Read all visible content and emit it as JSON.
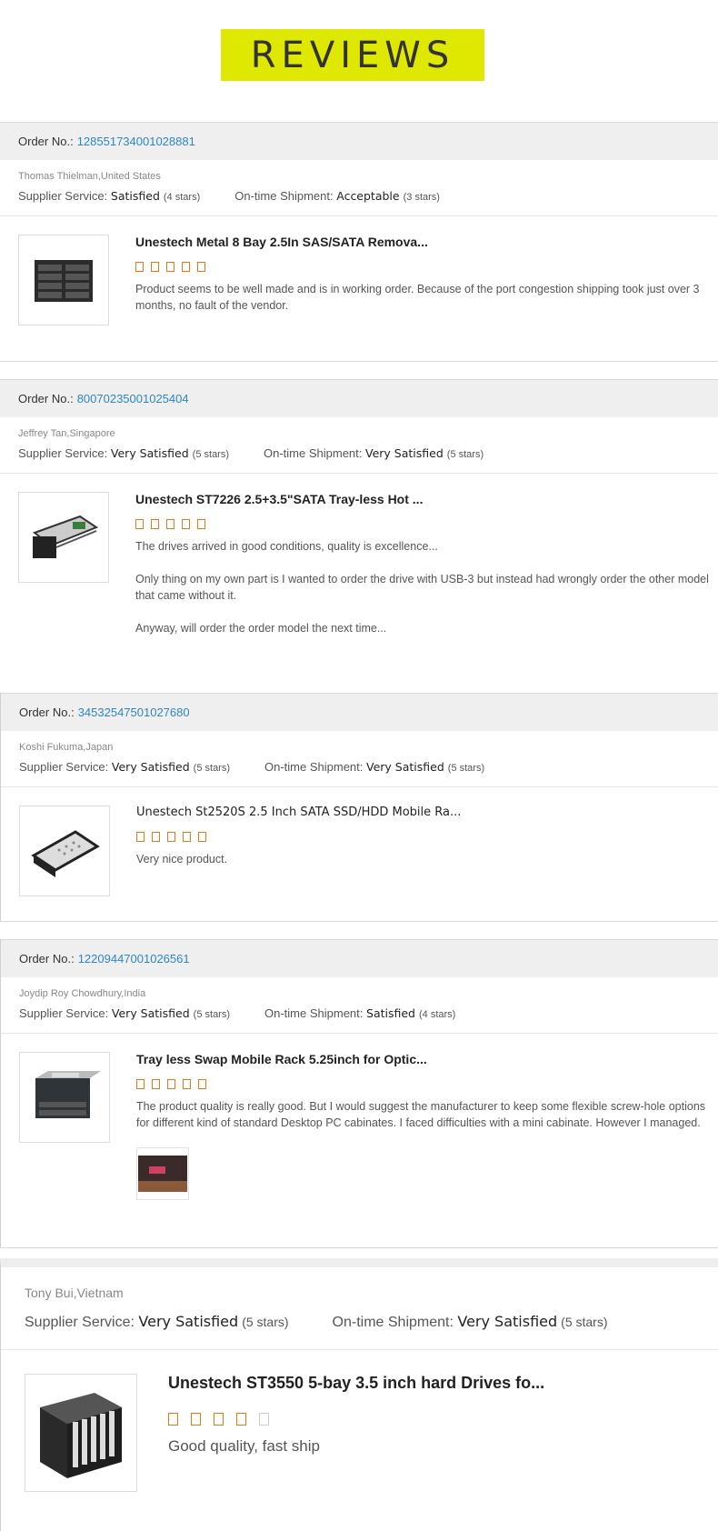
{
  "header": {
    "title": "REVIEWS",
    "bg_color": "#dfe800"
  },
  "accent_link_color": "#2e86c8",
  "star_color": "#e0781c",
  "reviews": [
    {
      "order_label": "Order No.:",
      "order_number": "128551734001028881",
      "buyer": "Thomas Thielman,United States",
      "supplier_label": "Supplier Service:",
      "supplier_value": "Satisfied",
      "supplier_stars": "(4 stars)",
      "shipment_label": "On-time Shipment:",
      "shipment_value": "Acceptable",
      "shipment_stars": "(3 stars)",
      "product_title": "Unestech Metal 8 Bay 2.5In SAS/SATA Remova...",
      "rating": 5,
      "text": "Product seems to be well made and is in working order. Because of the port congestion shipping took just over 3 months, no fault of the vendor."
    },
    {
      "order_label": "Order No.:",
      "order_number": "80070235001025404",
      "buyer": "Jeffrey Tan,Singapore",
      "supplier_label": "Supplier Service:",
      "supplier_value": "Very Satisfied",
      "supplier_stars": "(5 stars)",
      "shipment_label": "On-time Shipment:",
      "shipment_value": "Very Satisfied",
      "shipment_stars": "(5 stars)",
      "product_title": "Unestech ST7226 2.5+3.5\"SATA Tray-less Hot ...",
      "rating": 5,
      "text": "The drives arrived in good conditions, quality is excellence...\n\nOnly thing on my own part is I wanted to order the drive with USB-3 but instead had wrongly order the other model that came without it.\n\nAnyway, will order the order model the next time..."
    },
    {
      "order_label": "Order No.:",
      "order_number": "34532547501027680",
      "buyer": "Koshi Fukuma,Japan",
      "supplier_label": "Supplier Service:",
      "supplier_value": "Very Satisfied",
      "supplier_stars": "(5 stars)",
      "shipment_label": "On-time Shipment:",
      "shipment_value": "Very Satisfied",
      "shipment_stars": "(5 stars)",
      "product_title": "Unestech St2520S 2.5 Inch SATA SSD/HDD Mobile Ra...",
      "rating": 5,
      "text": "Very nice product."
    },
    {
      "order_label": "Order No.:",
      "order_number": "12209447001026561",
      "buyer": "Joydip Roy Chowdhury,India",
      "supplier_label": "Supplier Service:",
      "supplier_value": "Very Satisfied",
      "supplier_stars": "(5 stars)",
      "shipment_label": "On-time Shipment:",
      "shipment_value": "Satisfied",
      "shipment_stars": "(4 stars)",
      "product_title": "Tray less Swap Mobile Rack 5.25inch for Optic...",
      "rating": 5,
      "text": "The product quality is really good. But I would suggest the manufacturer to keep some flexible screw-hole options for different kind of standard Desktop PC cabinates. I faced difficulties with a mini cabinate. However I managed."
    },
    {
      "buyer": "Tony Bui,Vietnam",
      "supplier_label": "Supplier Service:",
      "supplier_value": "Very Satisfied",
      "supplier_stars": "(5 stars)",
      "shipment_label": "On-time Shipment:",
      "shipment_value": "Very Satisfied",
      "shipment_stars": "(5 stars)",
      "product_title": "Unestech ST3550 5-bay 3.5 inch hard Drives fo...",
      "rating": 4,
      "text": "Good quality, fast ship"
    }
  ]
}
